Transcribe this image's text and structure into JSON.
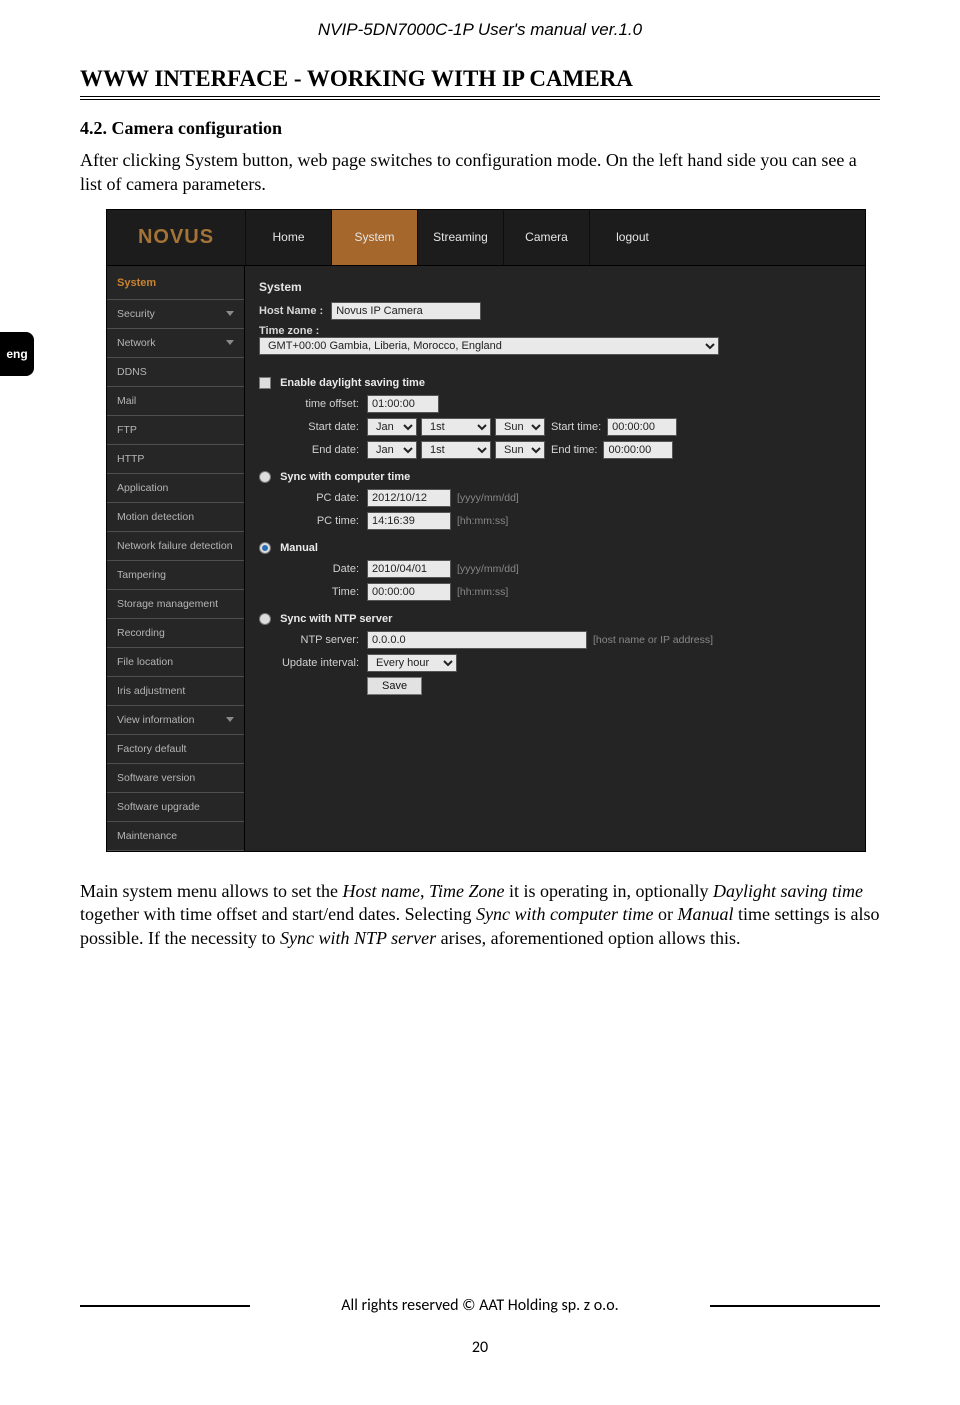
{
  "doc": {
    "running_head": "NVIP-5DN7000C-1P User's manual ver.1.0",
    "section_title": "WWW INTERFACE - WORKING WITH IP CAMERA",
    "subheading": "4.2. Camera configuration",
    "intro": "After clicking System button, web page switches to configuration mode. On the left hand side you can see a list of camera parameters.",
    "para2_a": "Main system menu allows to set the ",
    "para2_hostname": "Host name",
    "para2_b": ", ",
    "para2_timezone": "Time Zone",
    "para2_c": " it is operating in, optionally ",
    "para2_dst": "Daylight saving time",
    "para2_d": " together with time offset and start/end dates. Selecting ",
    "para2_sync": "Sync with computer time",
    "para2_e": " or ",
    "para2_manual": "Manual",
    "para2_f": " time settings is also possible. If the necessity to ",
    "para2_ntp": "Sync with NTP server",
    "para2_g": " arises, aforementioned option allows this.",
    "footer": "All rights reserved © AAT Holding sp. z o.o.",
    "page_number": "20",
    "lang_tab": "eng"
  },
  "ui": {
    "logo": "NOVUS",
    "topnav": {
      "home": "Home",
      "system": "System",
      "streaming": "Streaming",
      "camera": "Camera",
      "logout": "logout"
    },
    "sidebar": {
      "system": "System",
      "items": [
        "Security",
        "Network",
        "DDNS",
        "Mail",
        "FTP",
        "HTTP",
        "Application",
        "Motion detection",
        "Network failure detection",
        "Tampering",
        "Storage management",
        "Recording",
        "File location",
        "Iris adjustment",
        "View information",
        "Factory default",
        "Software version",
        "Software upgrade",
        "Maintenance"
      ]
    },
    "panel": {
      "heading": "System",
      "host_label": "Host Name :",
      "host_value": "Novus IP Camera",
      "tz_label": "Time zone :",
      "tz_value": "GMT+00:00 Gambia, Liberia, Morocco, England",
      "dst_label": "Enable daylight saving time",
      "offset_label": "time offset:",
      "offset_value": "01:00:00",
      "start_label": "Start date:",
      "end_label": "End date:",
      "month": "Jan",
      "day": "1st",
      "weekday": "Sun",
      "start_time_label": "Start time:",
      "end_time_label": "End time:",
      "zero_time": "00:00:00",
      "sync_pc": "Sync with computer time",
      "pc_date_label": "PC date:",
      "pc_date_value": "2012/10/12",
      "date_hint": "[yyyy/mm/dd]",
      "pc_time_label": "PC time:",
      "pc_time_value": "14:16:39",
      "time_hint": "[hh:mm:ss]",
      "manual": "Manual",
      "man_date_label": "Date:",
      "man_date_value": "2010/04/01",
      "man_time_label": "Time:",
      "man_time_value": "00:00:00",
      "sync_ntp": "Sync with NTP server",
      "ntp_label": "NTP server:",
      "ntp_value": "0.0.0.0",
      "ntp_hint": "[host name or IP address]",
      "interval_label": "Update interval:",
      "interval_value": "Every hour",
      "save": "Save"
    }
  }
}
